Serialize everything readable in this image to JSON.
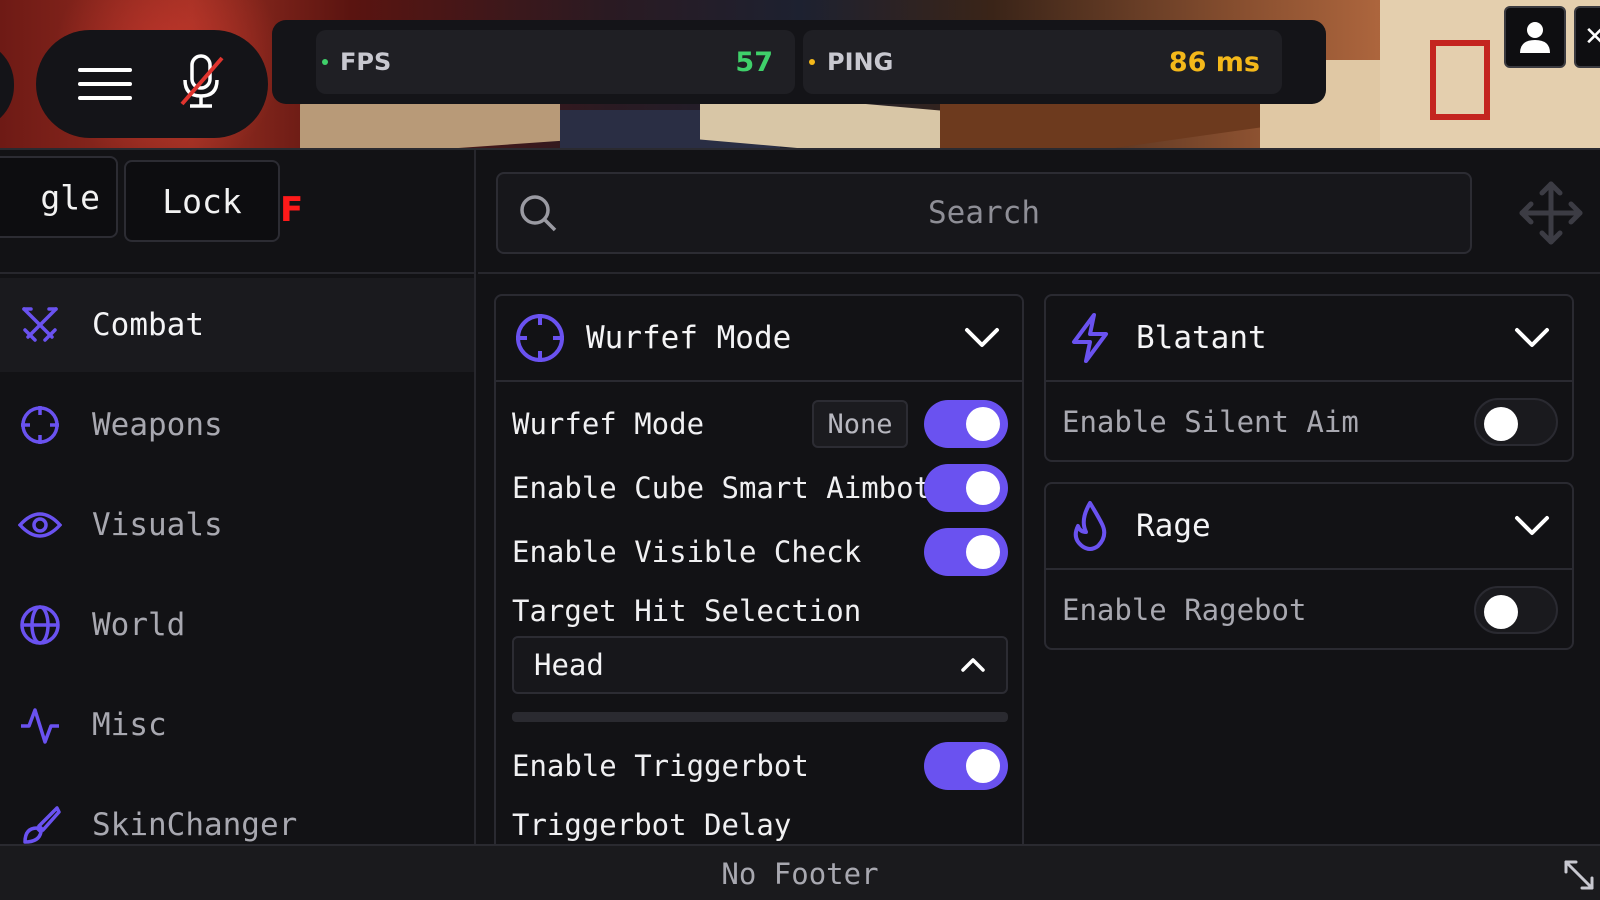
{
  "colors": {
    "accent": "#6a52f0",
    "fps_value": "#3fd06a",
    "ping_value": "#f4b81a",
    "keybind_badge": "#ff1a1a"
  },
  "hud": {
    "fps_label": "FPS",
    "fps_value": "57",
    "ping_label": "PING",
    "ping_value": "86 ms"
  },
  "toolbar": {
    "toggle_label": "gle",
    "lock_label": "Lock",
    "keybind": "F"
  },
  "search": {
    "placeholder": "Search"
  },
  "sidebar": {
    "items": [
      {
        "label": "Combat",
        "icon": "swords-icon"
      },
      {
        "label": "Weapons",
        "icon": "crosshair-icon"
      },
      {
        "label": "Visuals",
        "icon": "eye-icon"
      },
      {
        "label": "World",
        "icon": "globe-icon"
      },
      {
        "label": "Misc",
        "icon": "activity-icon"
      },
      {
        "label": "SkinChanger",
        "icon": "brush-icon"
      }
    ]
  },
  "panels": {
    "wurfef": {
      "title": "Wurfef Mode",
      "rows": {
        "mode_label": "Wurfef Mode",
        "mode_key": "None",
        "smart_aimbot": "Enable Cube Smart Aimbot",
        "visible_check": "Enable Visible Check",
        "target_hit": "Target Hit Selection",
        "target_value": "Head",
        "triggerbot": "Enable Triggerbot",
        "triggerbot_delay": "Triggerbot Delay"
      },
      "states": {
        "mode": true,
        "smart_aimbot": true,
        "visible_check": true,
        "triggerbot": true
      }
    },
    "blatant": {
      "title": "Blatant",
      "silent_aim": "Enable Silent Aim",
      "silent_aim_on": false
    },
    "rage": {
      "title": "Rage",
      "ragebot": "Enable Ragebot",
      "ragebot_on": false
    }
  },
  "footer": {
    "text": "No Footer"
  }
}
